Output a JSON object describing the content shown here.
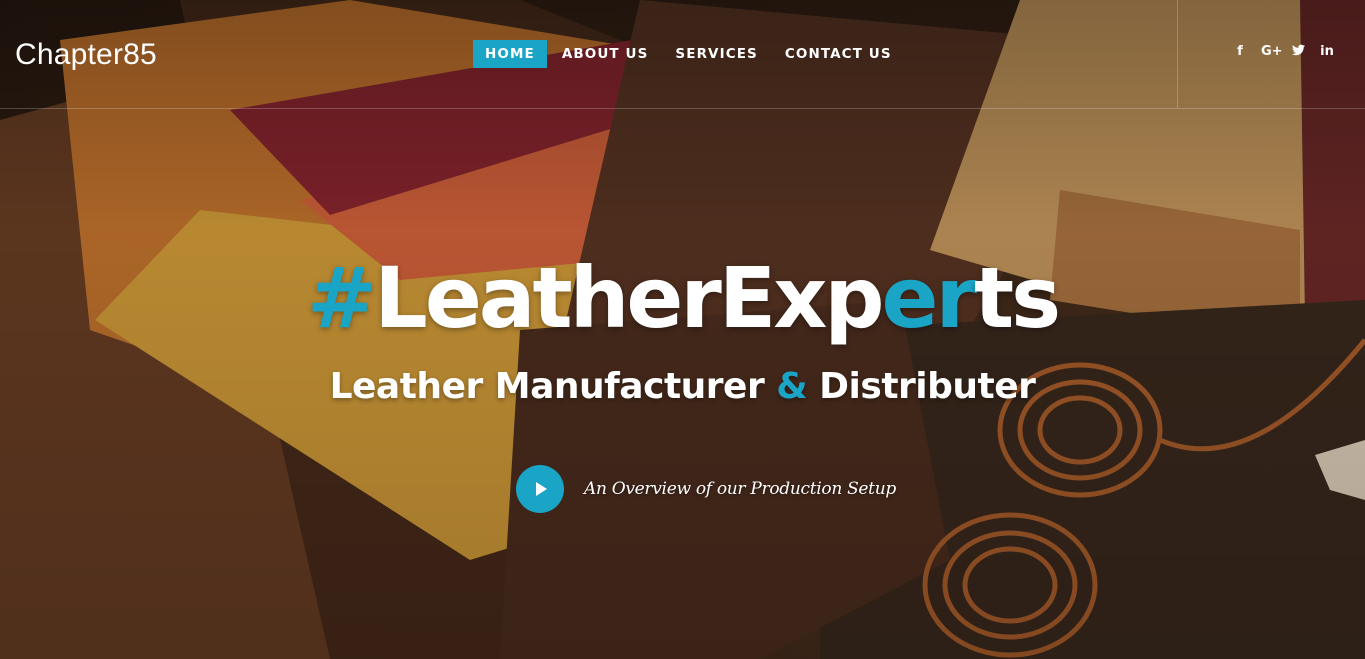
{
  "brand": {
    "logo_text": "Chapter85"
  },
  "nav": {
    "items": [
      {
        "label": "HOME",
        "active": true
      },
      {
        "label": "ABOUT US",
        "active": false
      },
      {
        "label": "SERVICES",
        "active": false
      },
      {
        "label": "CONTACT US",
        "active": false
      }
    ]
  },
  "social": {
    "icons": [
      {
        "name": "facebook-icon",
        "glyph": "f"
      },
      {
        "name": "google-plus-icon",
        "glyph": "G+"
      },
      {
        "name": "twitter-icon",
        "glyph": "t"
      },
      {
        "name": "linkedin-icon",
        "glyph": "in"
      }
    ]
  },
  "hero": {
    "headline": {
      "part1": "#",
      "part2": "LeatherExp",
      "part3": "er",
      "part4": "ts"
    },
    "subline": {
      "part1": "Leather Manufacturer ",
      "part2": "&",
      "part3": " Distributer"
    },
    "video": {
      "caption": "An Overview of our Production Setup"
    }
  },
  "colors": {
    "accent": "#1aa4c6",
    "text": "#ffffff"
  }
}
